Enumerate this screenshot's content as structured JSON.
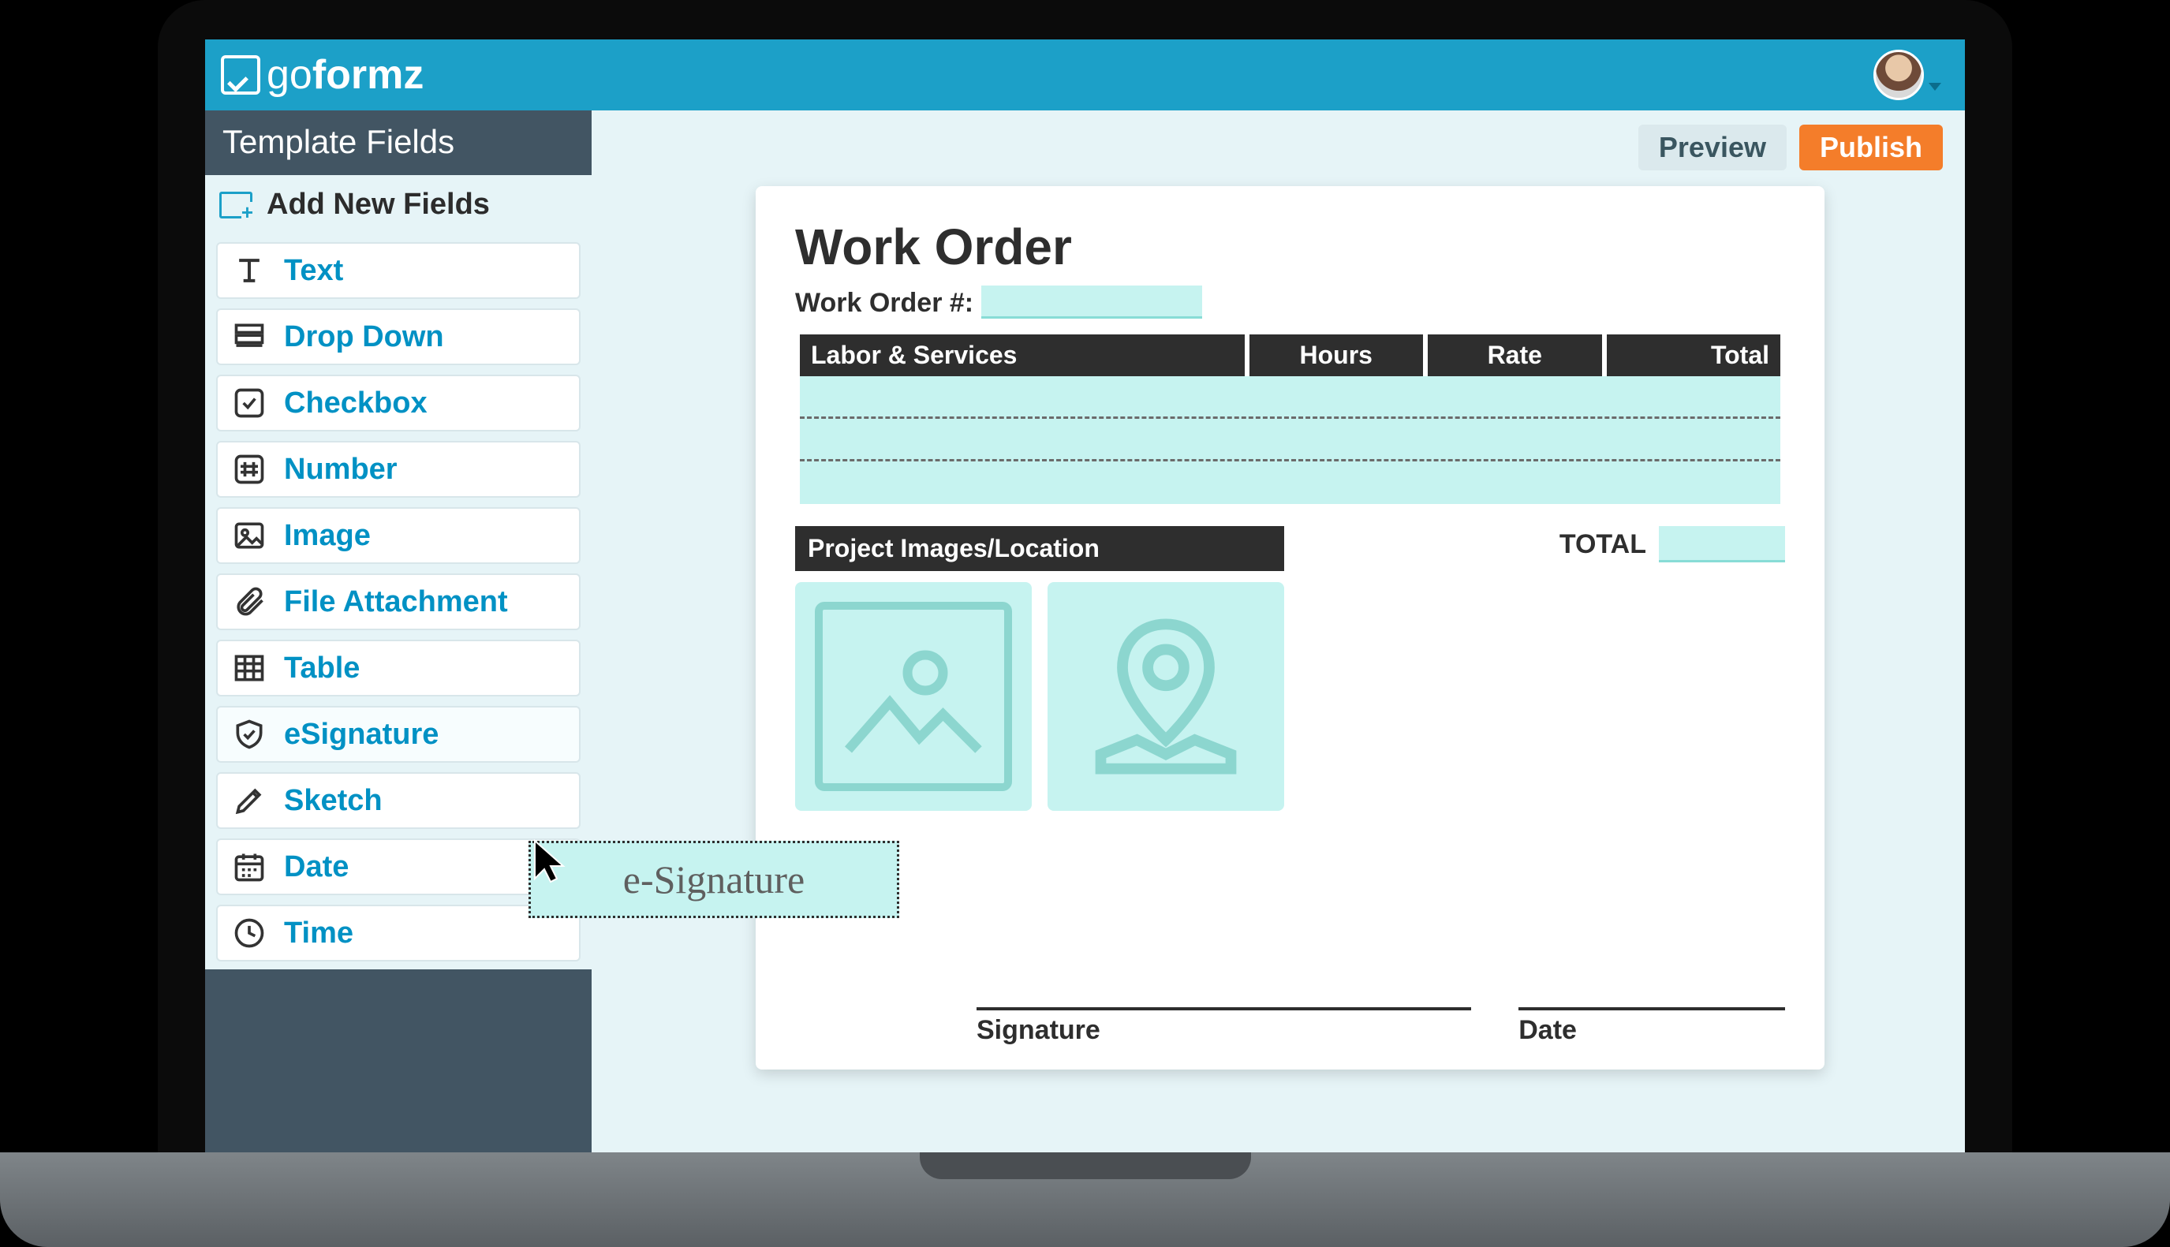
{
  "brand": {
    "name_prefix": "go",
    "name_bold": "formz"
  },
  "sidebar": {
    "title": "Template Fields",
    "add_new_label": "Add New Fields",
    "fields": [
      {
        "label": "Text"
      },
      {
        "label": "Drop Down"
      },
      {
        "label": "Checkbox"
      },
      {
        "label": "Number"
      },
      {
        "label": "Image"
      },
      {
        "label": "File Attachment"
      },
      {
        "label": "Table"
      },
      {
        "label": "eSignature"
      },
      {
        "label": "Sketch"
      },
      {
        "label": "Date"
      },
      {
        "label": "Time"
      }
    ]
  },
  "actions": {
    "preview": "Preview",
    "publish": "Publish"
  },
  "form": {
    "title": "Work Order",
    "wo_label": "Work Order #:",
    "table_headers": [
      "Labor & Services",
      "Hours",
      "Rate",
      "Total"
    ],
    "section_header": "Project Images/Location",
    "total_label": "TOTAL",
    "signature_label": "Signature",
    "date_label": "Date"
  },
  "drag_ghost": {
    "label": "e-Signature"
  },
  "colors": {
    "brand_blue": "#1ca0c8",
    "accent_orange": "#f47d2a",
    "field_highlight": "#c6f3f0"
  }
}
